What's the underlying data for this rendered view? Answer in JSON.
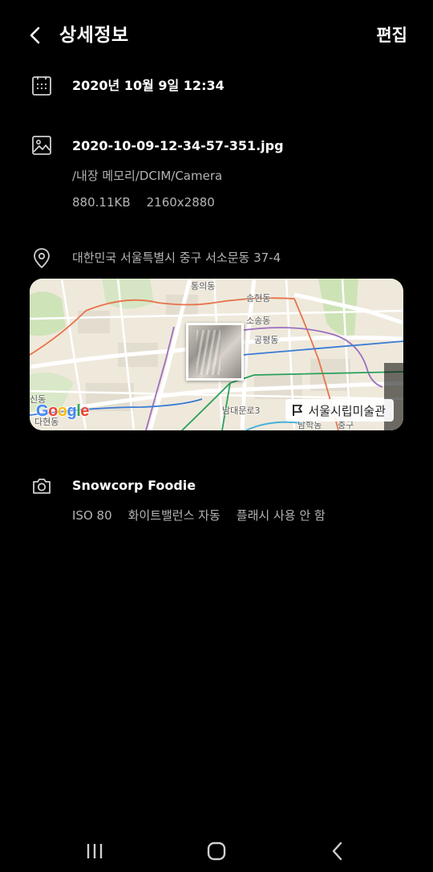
{
  "header": {
    "title": "상세정보",
    "edit_label": "편집"
  },
  "datetime": {
    "value": "2020년 10월 9일 12:34"
  },
  "file": {
    "name": "2020-10-09-12-34-57-351.jpg",
    "path": "/내장 메모리/DCIM/Camera",
    "size": "880.11KB",
    "resolution": "2160x2880"
  },
  "location": {
    "address": "대한민국 서울특별시 중구 서소문동 37-4",
    "map": {
      "place_chip": "서울시립미술관",
      "labels": [
        "통의동",
        "송현동",
        "소송동",
        "공평동",
        "신동",
        "다현동",
        "남대문로3",
        "남학동",
        "충구"
      ],
      "google_logo": [
        "G",
        "o",
        "o",
        "g",
        "l",
        "e"
      ]
    }
  },
  "camera": {
    "model": "Snowcorp Foodie",
    "iso": "ISO 80",
    "white_balance": "화이트밸런스 자동",
    "flash": "플래시 사용 안 함"
  },
  "navbar": {
    "recent_icon": "recent-apps-icon",
    "home_icon": "home-icon",
    "back_icon": "back-icon"
  },
  "colors": {
    "background": "#000000",
    "primary_text": "#ffffff",
    "secondary_text": "#b4b4b4"
  }
}
